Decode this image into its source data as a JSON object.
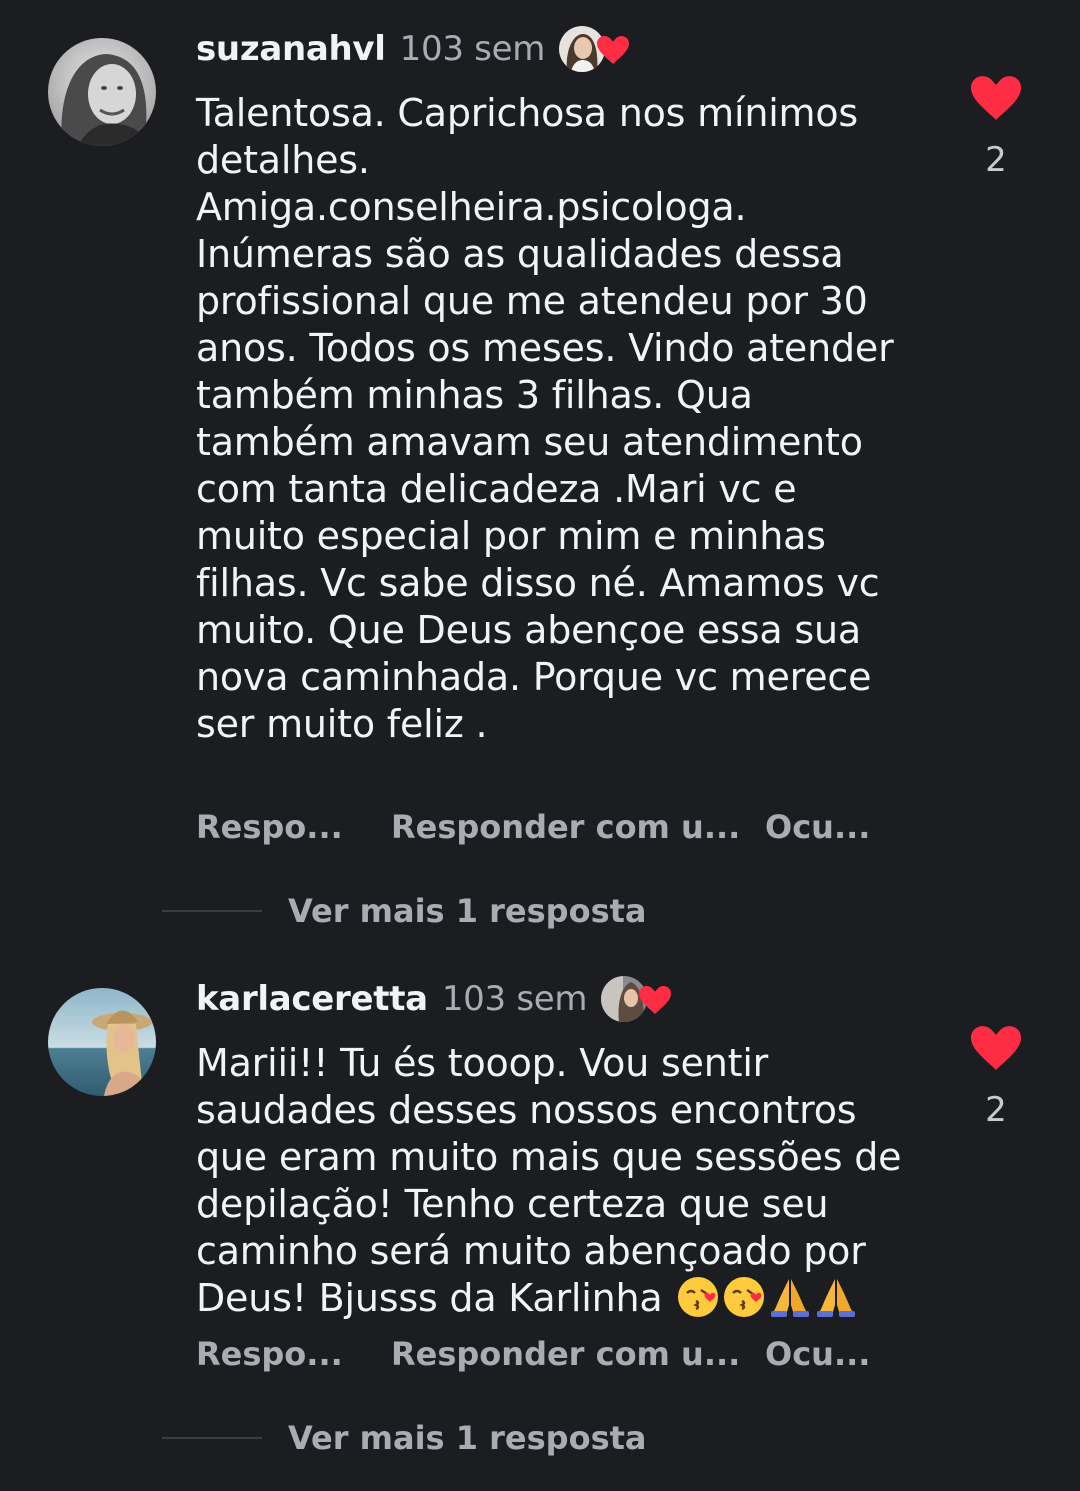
{
  "comments": [
    {
      "username": "suzanahvl",
      "time": "103 sem",
      "text": "Talentosa. Caprichosa nos mínimos detalhes.\nAmiga.conselheira.psicologa. Inúmeras são as qualidades dessa profissional que me atendeu por 30 anos. Todos os meses. Vindo atender também minhas 3 filhas. Qua também amavam seu atendimento com tanta delicadeza .Mari vc  e muito especial por mim e minhas filhas. Vc sabe disso né.  Amamos vc muito. Que Deus abençoe essa sua nova caminhada.  Porque vc merece ser muito feliz .",
      "like_count": "2",
      "actions": {
        "reply": "Respo...",
        "reply_with": "Responder com u...",
        "hide": "Ocu..."
      },
      "more_replies": "Ver mais 1 resposta"
    },
    {
      "username": "karlaceretta",
      "time": "103 sem",
      "text": "Mariii!! Tu és tooop. Vou sentir saudades  desses nossos encontros que eram muito mais que sessões de depilação! Tenho certeza que seu caminho será muito abençoado por Deus! Bjusss da Karlinha",
      "like_count": "2",
      "actions": {
        "reply": "Respo...",
        "reply_with": "Responder com u...",
        "hide": "Ocu..."
      },
      "more_replies": "Ver mais 1 resposta"
    }
  ],
  "icons": {
    "like": "heart-icon",
    "author_liked": "author-liked-heart-icon",
    "emojis": [
      "kissing-face-with-heart-emoji",
      "kissing-face-with-heart-emoji",
      "folded-hands-emoji",
      "folded-hands-emoji"
    ]
  },
  "colors": {
    "background": "#1b1d21",
    "heart": "#ff2d44",
    "primary_text": "#f1f3f5",
    "secondary_text": "#a8adb4"
  }
}
